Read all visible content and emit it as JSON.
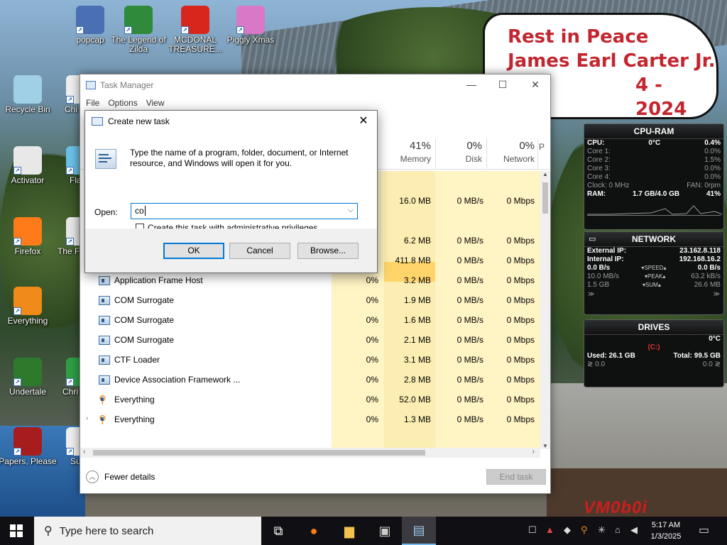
{
  "desktop": {
    "icons": [
      {
        "label": "popcap",
        "icon": "popcap-icon",
        "color": "#4a6fb3"
      },
      {
        "label": "The Legend of Zilda",
        "icon": "zelda-icon",
        "color": "#2f8a3c"
      },
      {
        "label": "MCDONAL TREASURE...",
        "icon": "mcdonalds-icon",
        "color": "#d9261c"
      },
      {
        "label": "Piggly Xmas",
        "icon": "piggly-icon",
        "color": "#d978c7"
      },
      {
        "label": "Recycle Bin",
        "icon": "recycle-bin-icon",
        "color": "#9fd0e6"
      },
      {
        "label": "Chi Inva",
        "icon": "chicken-invaders-icon",
        "color": "#eeeeee"
      },
      {
        "label": "Activator",
        "icon": "activator-icon",
        "color": "#e8e8e8"
      },
      {
        "label": "Flapp",
        "icon": "flappy-icon",
        "color": "#6ac1e6"
      },
      {
        "label": "Firefox",
        "icon": "firefox-icon",
        "color": "#ff7a18"
      },
      {
        "label": "The F Mach",
        "icon": "machine-icon",
        "color": "#e6e6e6"
      },
      {
        "label": "Everything",
        "icon": "everything-icon",
        "color": "#f08a18"
      },
      {
        "label": "Undertale",
        "icon": "undertale-icon",
        "color": "#2d7a2d"
      },
      {
        "label": "Chri Brov",
        "icon": "chrome-browser-icon",
        "color": "#2e9e45"
      },
      {
        "label": "Papers, Please",
        "icon": "papers-please-icon",
        "color": "#a71d1d"
      },
      {
        "label": "Supe",
        "icon": "super-icon",
        "color": "#eeeeee"
      }
    ],
    "banner": [
      "Rest in Peace",
      "James Earl Carter Jr.",
      "4 - 2024"
    ],
    "watermark": "VM0b0i"
  },
  "cpu_ram": {
    "title": "CPU-RAM",
    "cpu_label": "CPU:",
    "cpu_temp": "0°C",
    "cpu_value": "0.4%",
    "cores": [
      {
        "label": "Core 1:",
        "value": "0.0%"
      },
      {
        "label": "Core 2:",
        "value": "1.5%"
      },
      {
        "label": "Core 3:",
        "value": "0.0%"
      },
      {
        "label": "Core 4:",
        "value": "0.0%"
      }
    ],
    "clock": "Clock: 0 MHz",
    "fan": "FAN: 0rpm",
    "ram_label": "RAM:",
    "ram_value": "1.7 GB/4.0 GB",
    "ram_pct": "41%"
  },
  "network": {
    "title": "NETWORK",
    "external_label": "External IP:",
    "external_ip": "23.162.8.118",
    "internal_label": "Internal IP:",
    "internal_ip": "192.168.16.2",
    "speed_left": "0.0 B/s",
    "speed_label": "▾SPEED▴",
    "speed_right": "0.0 B/s",
    "peak_left": "10.0 MB/s",
    "peak_label": "▾PEAK▴",
    "peak_right": "63.2 kB/s",
    "sum_left": "1.5 GB",
    "sum_label": "▾SUM▴",
    "sum_right": "26.6 MB"
  },
  "drives": {
    "title": "DRIVES",
    "temp": "0°C",
    "drive": "(C:)",
    "used": "Used: 26.1 GB",
    "total": "Total: 99.5 GB",
    "read": "0.0",
    "write": "0.0"
  },
  "task_manager": {
    "title": "Task Manager",
    "menu": [
      "File",
      "Options",
      "View"
    ],
    "columns": [
      {
        "pct": "41%",
        "label": "Memory"
      },
      {
        "pct": "0%",
        "label": "Disk"
      },
      {
        "pct": "0%",
        "label": "Network"
      },
      {
        "pct": "",
        "label": "P"
      }
    ],
    "rows": [
      {
        "name": "",
        "cpu": "",
        "mem": "",
        "disk": "",
        "net": ""
      },
      {
        "name": "",
        "cpu": "",
        "mem": "16.0 MB",
        "disk": "0 MB/s",
        "net": "0 Mbps"
      },
      {
        "name": "",
        "cpu": "",
        "mem": "",
        "disk": "",
        "net": ""
      },
      {
        "name": "",
        "cpu": "",
        "mem": "6.2 MB",
        "disk": "0 MB/s",
        "net": "0 Mbps"
      },
      {
        "name": "Antimalware Service Executable",
        "cpu": "",
        "mem": "411.8 MB",
        "disk": "0 MB/s",
        "net": "0 Mbps"
      },
      {
        "name": "Application Frame Host",
        "cpu": "0%",
        "mem": "3.2 MB",
        "disk": "0 MB/s",
        "net": "0 Mbps"
      },
      {
        "name": "COM Surrogate",
        "cpu": "0%",
        "mem": "1.9 MB",
        "disk": "0 MB/s",
        "net": "0 Mbps"
      },
      {
        "name": "COM Surrogate",
        "cpu": "0%",
        "mem": "1.6 MB",
        "disk": "0 MB/s",
        "net": "0 Mbps"
      },
      {
        "name": "COM Surrogate",
        "cpu": "0%",
        "mem": "2.1 MB",
        "disk": "0 MB/s",
        "net": "0 Mbps"
      },
      {
        "name": "CTF Loader",
        "cpu": "0%",
        "mem": "3.1 MB",
        "disk": "0 MB/s",
        "net": "0 Mbps"
      },
      {
        "name": "Device Association Framework ...",
        "cpu": "0%",
        "mem": "2.8 MB",
        "disk": "0 MB/s",
        "net": "0 Mbps"
      },
      {
        "name": "Everything",
        "cpu": "0%",
        "mem": "52.0 MB",
        "disk": "0 MB/s",
        "net": "0 Mbps"
      },
      {
        "name": "Everything",
        "cpu": "0%",
        "mem": "1.3 MB",
        "disk": "0 MB/s",
        "net": "0 Mbps"
      }
    ],
    "fewer_details": "Fewer details",
    "end_task": "End task"
  },
  "dialog": {
    "title": "Create new task",
    "description": "Type the name of a program, folder, document, or Internet resource, and Windows will open it for you.",
    "open_label": "Open:",
    "open_value": "co",
    "admin_checkbox": "Create this task with administrative privileges.",
    "ok": "OK",
    "cancel": "Cancel",
    "browse": "Browse..."
  },
  "taskbar": {
    "search_placeholder": "Type here to search",
    "time": "5:17 AM",
    "date": "1/3/2025"
  }
}
